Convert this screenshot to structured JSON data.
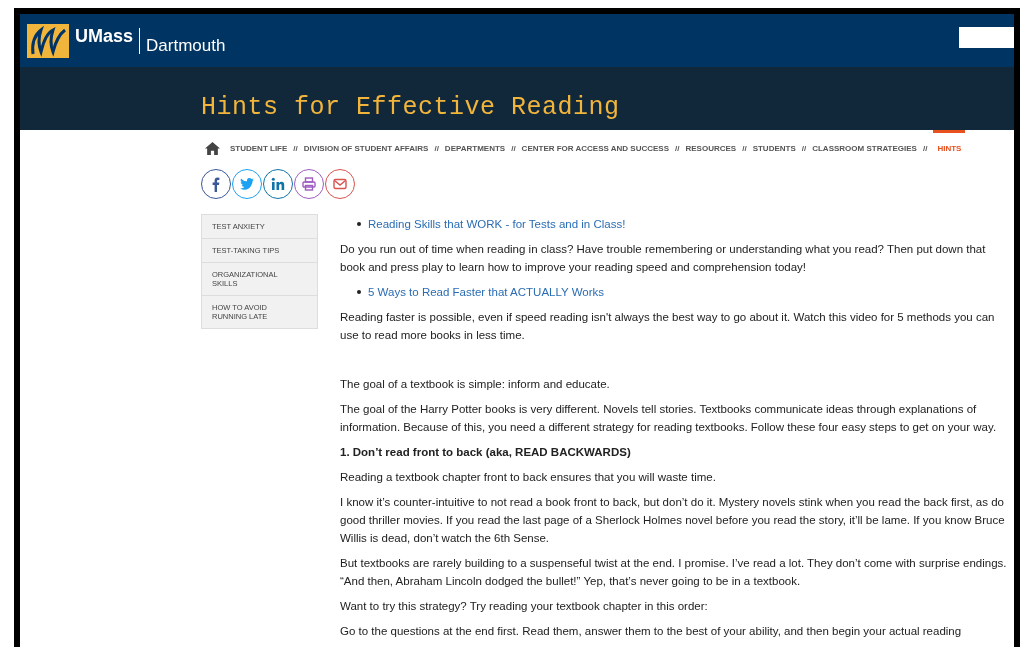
{
  "header": {
    "brand": "UMass",
    "campus": "Dartmouth"
  },
  "page_title": "Hints for Effective Reading",
  "breadcrumb": [
    {
      "label": "STUDENT LIFE",
      "selected": false
    },
    {
      "label": "DIVISION OF STUDENT AFFAIRS",
      "selected": false
    },
    {
      "label": "DEPARTMENTS",
      "selected": false
    },
    {
      "label": "CENTER FOR ACCESS AND SUCCESS",
      "selected": false
    },
    {
      "label": "RESOURCES",
      "selected": false
    },
    {
      "label": "STUDENTS",
      "selected": false
    },
    {
      "label": "CLASSROOM STRATEGIES",
      "selected": false
    },
    {
      "label": "HINTS",
      "selected": true
    }
  ],
  "breadcrumb_separator": "//",
  "share": [
    {
      "kind": "facebook",
      "color": "#3b5998"
    },
    {
      "kind": "twitter",
      "color": "#1da1f2"
    },
    {
      "kind": "linkedin",
      "color": "#0e76a8"
    },
    {
      "kind": "print",
      "color": "#a05cc0"
    },
    {
      "kind": "email",
      "color": "#d9534f"
    }
  ],
  "sidebar": {
    "items": [
      "TEST ANXIETY",
      "TEST-TAKING TIPS",
      "ORGANIZATIONAL SKILLS",
      "HOW TO AVOID RUNNING LATE"
    ]
  },
  "content": [
    {
      "kind": "link",
      "text": "Reading Skills that WORK - for Tests and in Class!"
    },
    {
      "kind": "paragraph",
      "text": "Do you run out of time when reading in class? Have trouble remembering or understanding what you read? Then put down that book and press play to learn how to improve your reading speed and comprehension today!"
    },
    {
      "kind": "link",
      "text": "5 Ways to Read Faster that ACTUALLY Works"
    },
    {
      "kind": "paragraph",
      "text": "Reading faster is possible, even if speed reading isn't always the best way to go about it. Watch this video for 5 methods you can use to read more books in less time."
    },
    {
      "kind": "spacer"
    },
    {
      "kind": "paragraph",
      "text": "The goal of a textbook is simple: inform and educate."
    },
    {
      "kind": "paragraph",
      "text": "The goal of the Harry Potter books is very different. Novels tell stories. Textbooks communicate ideas through explanations of information. Because of this, you need a different strategy for reading textbooks. Follow these four easy steps to get on your way."
    },
    {
      "kind": "heading",
      "text": "1. Don’t read front to back (aka, READ BACKWARDS)"
    },
    {
      "kind": "paragraph",
      "text": "Reading a textbook chapter front to back ensures that you will waste time."
    },
    {
      "kind": "paragraph",
      "text": "I know it’s counter-intuitive to not read a book front to back, but don’t do it. Mystery novels stink when you read the back first, as do good thriller movies. If you read the last page of a Sherlock Holmes novel before you read the story, it’ll be lame. If you know Bruce Willis is dead, don’t watch the 6th Sense."
    },
    {
      "kind": "paragraph",
      "text": "But textbooks are rarely building to a suspenseful twist at the end. I promise. I’ve read a lot. They don’t come with surprise endings. “And then, Abraham Lincoln dodged the bullet!” Yep, that’s never going to be in a textbook."
    },
    {
      "kind": "paragraph",
      "text": "Want to try this strategy? Try reading your textbook chapter in this order:"
    },
    {
      "kind": "paragraph",
      "text": "Go to the questions at the end first. Read them, answer them to the best of your ability, and then begin your actual reading"
    }
  ]
}
